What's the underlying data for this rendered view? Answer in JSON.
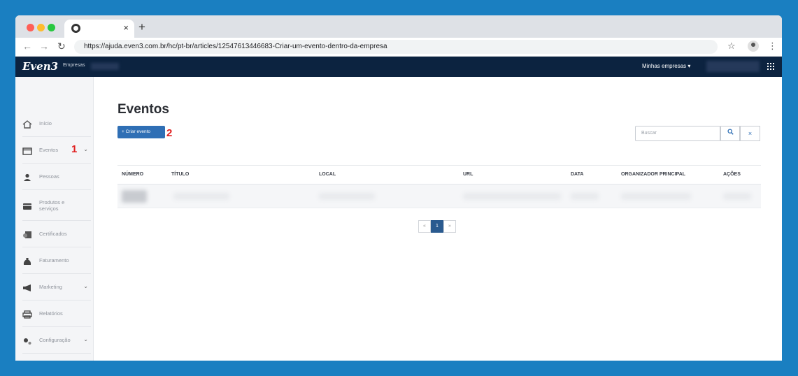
{
  "browser": {
    "url": "https://ajuda.even3.com.br/hc/pt-br/articles/12547613446683-Criar-um-evento-dentro-da-empresa",
    "tab_close": "×",
    "new_tab": "+"
  },
  "app": {
    "logo": "Even3",
    "logo_sub": "Empresas",
    "companies_menu": "Minhas empresas ▾"
  },
  "sidebar": {
    "items": [
      {
        "label": "Início"
      },
      {
        "label": "Eventos"
      },
      {
        "label": "Pessoas"
      },
      {
        "label": "Produtos e serviços"
      },
      {
        "label": "Certificados"
      },
      {
        "label": "Faturamento"
      },
      {
        "label": "Marketing"
      },
      {
        "label": "Relatórios"
      },
      {
        "label": "Configuração"
      }
    ]
  },
  "annotations": {
    "one": "1",
    "two": "2"
  },
  "main": {
    "title": "Eventos",
    "create_button": "+ Criar evento",
    "search_placeholder": "Buscar",
    "search_icon": "search-icon",
    "clear_icon": "close-icon",
    "columns": [
      "NÚMERO",
      "TÍTULO",
      "LOCAL",
      "URL",
      "DATA",
      "ORGANIZADOR PRINCIPAL",
      "AÇÕES"
    ],
    "pagination": {
      "prev": "«",
      "current": "1",
      "next": "»"
    }
  },
  "colors": {
    "accent": "#2f6fb5",
    "header": "#0c2340",
    "background": "#1a7fc1"
  }
}
